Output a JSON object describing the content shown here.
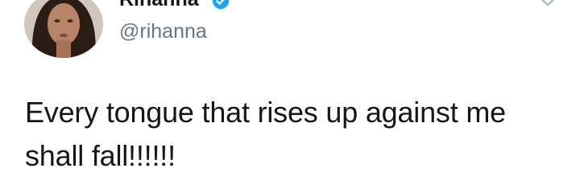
{
  "tweet": {
    "display_name": "Rihanna",
    "handle": "@rihanna",
    "text_line_1": "Every tongue that rises up against me",
    "text_line_2": "shall fall!!!!!!"
  },
  "icons": {
    "verified": "verified-badge-icon",
    "caret": "chevron-down-icon",
    "avatar": "profile-photo"
  },
  "colors": {
    "name": "#14171a",
    "handle": "#657786",
    "verified": "#1da1f2",
    "caret": "#aab8c2"
  }
}
